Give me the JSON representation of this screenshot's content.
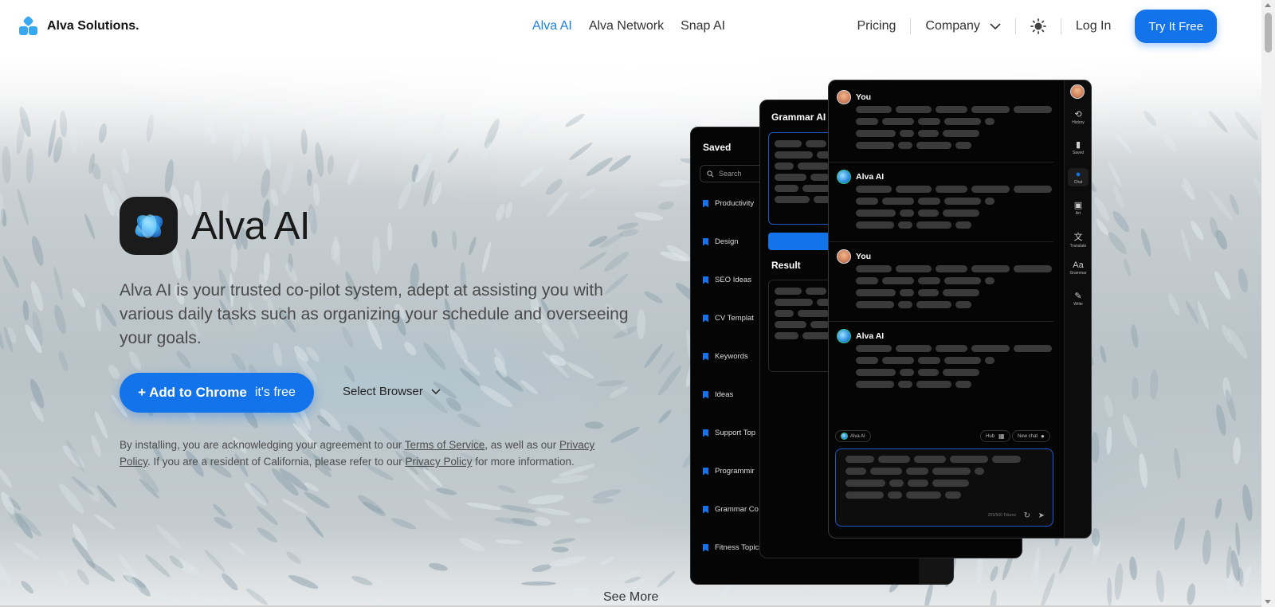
{
  "brand": {
    "name": "Alva Solutions."
  },
  "nav": {
    "items": [
      {
        "label": "Alva AI",
        "active": true
      },
      {
        "label": "Alva Network",
        "active": false
      },
      {
        "label": "Snap AI",
        "active": false
      }
    ],
    "pricing": "Pricing",
    "company": "Company",
    "login": "Log In",
    "try": "Try It Free"
  },
  "hero": {
    "title": "Alva AI",
    "description": "Alva AI is your trusted co-pilot system, adept at assisting you with various daily tasks such as organizing your schedule and overseeing your goals.",
    "cta_main": "+ Add to Chrome",
    "cta_sub": "it's free",
    "select_browser": "Select Browser",
    "legal": {
      "p1": "By installing, you are acknowledging your agreement to our ",
      "terms": "Terms of Service",
      "p2": ", as well as our ",
      "privacy1": "Privacy Policy",
      "p3": ". If you are a resident of California, please refer to our ",
      "privacy2": "Privacy Policy",
      "p4": " for more information."
    },
    "see_more": "See More"
  },
  "mock": {
    "saved": {
      "title": "Saved",
      "search_placeholder": "Search",
      "items": [
        "Productivity",
        "Design",
        "SEO Ideas",
        "CV Templat",
        "Keywords",
        "Ideas",
        "Support Top",
        "Programmir",
        "Grammar Co",
        "Fitness Topics"
      ]
    },
    "grammar": {
      "title": "Grammar AI",
      "result": "Result"
    },
    "chat": {
      "messages": [
        {
          "sender": "You"
        },
        {
          "sender": "Alva AI"
        },
        {
          "sender": "You"
        },
        {
          "sender": "Alva AI"
        }
      ],
      "model_chip": "Alva AI",
      "hub_chip": "Hub",
      "new_chat_chip": "New chat",
      "tokens": "255/500 Tokens",
      "sidebar": [
        "History",
        "Saved",
        "Chat",
        "Art",
        "Translate",
        "Grammar",
        "Write"
      ]
    }
  },
  "colors": {
    "accent": "#1273eb",
    "nav_active": "#1a7fe8",
    "logo": "#39a8f0"
  }
}
